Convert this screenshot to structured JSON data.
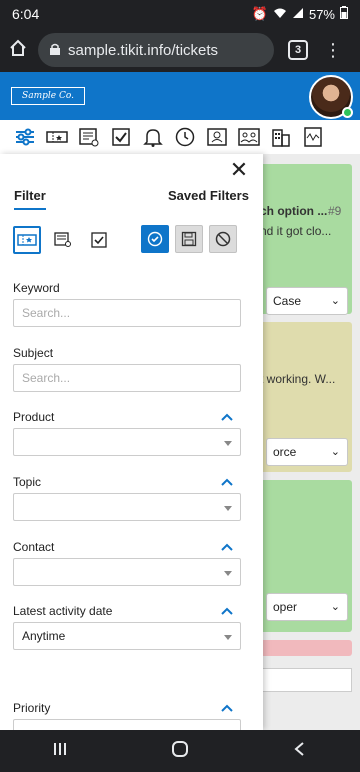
{
  "status_bar": {
    "time": "6:04",
    "battery": "57%"
  },
  "browser": {
    "url": "sample.tikit.info/tickets",
    "tab_count": "3"
  },
  "app": {
    "logo_text": "Sample Co."
  },
  "toolbar_icons": [
    "filter-sliders-icon",
    "ticket-icon",
    "invoice-icon",
    "checkbox-icon",
    "bell-icon",
    "history-clock-icon",
    "contact-card-icon",
    "team-icon",
    "building-icon",
    "dashboard-icon"
  ],
  "background_cards": [
    {
      "title_fragment": "ch option ...",
      "number": "#9",
      "text_fragment": "nd it got clo...",
      "select_value": "Case"
    },
    {
      "text_fragment": "t working. W...",
      "select_value": "orce"
    },
    {
      "select_value": "oper"
    }
  ],
  "drawer": {
    "tab_filter": "Filter",
    "tab_saved": "Saved Filters",
    "fields": {
      "keyword": {
        "label": "Keyword",
        "placeholder": "Search..."
      },
      "subject": {
        "label": "Subject",
        "placeholder": "Search..."
      },
      "product": {
        "label": "Product",
        "value": ""
      },
      "topic": {
        "label": "Topic",
        "value": ""
      },
      "contact": {
        "label": "Contact",
        "value": ""
      },
      "latest_activity": {
        "label": "Latest activity date",
        "value": "Anytime"
      },
      "priority": {
        "label": "Priority"
      }
    }
  },
  "colors": {
    "brand_blue": "#0f75c9",
    "card_green": "#a9dba0",
    "card_yellow": "#dfdcad",
    "card_pink": "#f1b9bd"
  }
}
